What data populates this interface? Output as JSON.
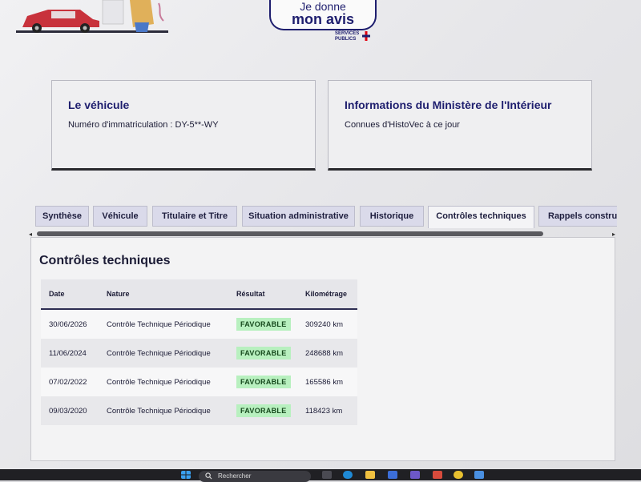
{
  "header": {
    "badge_line1": "Je donne",
    "badge_line2": "mon avis",
    "logo_line1": "SERVICES",
    "logo_line2": "PUBLICS"
  },
  "cards": {
    "vehicle": {
      "title": "Le véhicule",
      "text": "Numéro d'immatriculation : DY-5**-WY"
    },
    "ministry": {
      "title": "Informations du Ministère de l'Intérieur",
      "text": "Connues d'HistoVec à ce jour"
    }
  },
  "tabs": [
    {
      "label": "Synthèse"
    },
    {
      "label": "Véhicule"
    },
    {
      "label": "Titulaire et Titre"
    },
    {
      "label": "Situation administrative"
    },
    {
      "label": "Historique"
    },
    {
      "label": "Contrôles techniques"
    },
    {
      "label": "Rappels constru"
    }
  ],
  "active_tab": "Contrôles techniques",
  "panel": {
    "title": "Contrôles techniques",
    "columns": [
      "Date",
      "Nature",
      "Résultat",
      "Kilométrage"
    ],
    "rows": [
      {
        "date": "30/06/2026",
        "nature": "Contrôle Technique Périodique",
        "result": "FAVORABLE",
        "km": "309240 km"
      },
      {
        "date": "11/06/2024",
        "nature": "Contrôle Technique Périodique",
        "result": "FAVORABLE",
        "km": "248688 km"
      },
      {
        "date": "07/02/2022",
        "nature": "Contrôle Technique Périodique",
        "result": "FAVORABLE",
        "km": "165586 km"
      },
      {
        "date": "09/03/2020",
        "nature": "Contrôle Technique Périodique",
        "result": "FAVORABLE",
        "km": "118423 km"
      }
    ]
  },
  "taskbar": {
    "search_label": "Rechercher"
  },
  "colors": {
    "brand_navy": "#1e1e6e",
    "success_bg": "#b8f0bf",
    "tab_bg": "#dadaea"
  }
}
